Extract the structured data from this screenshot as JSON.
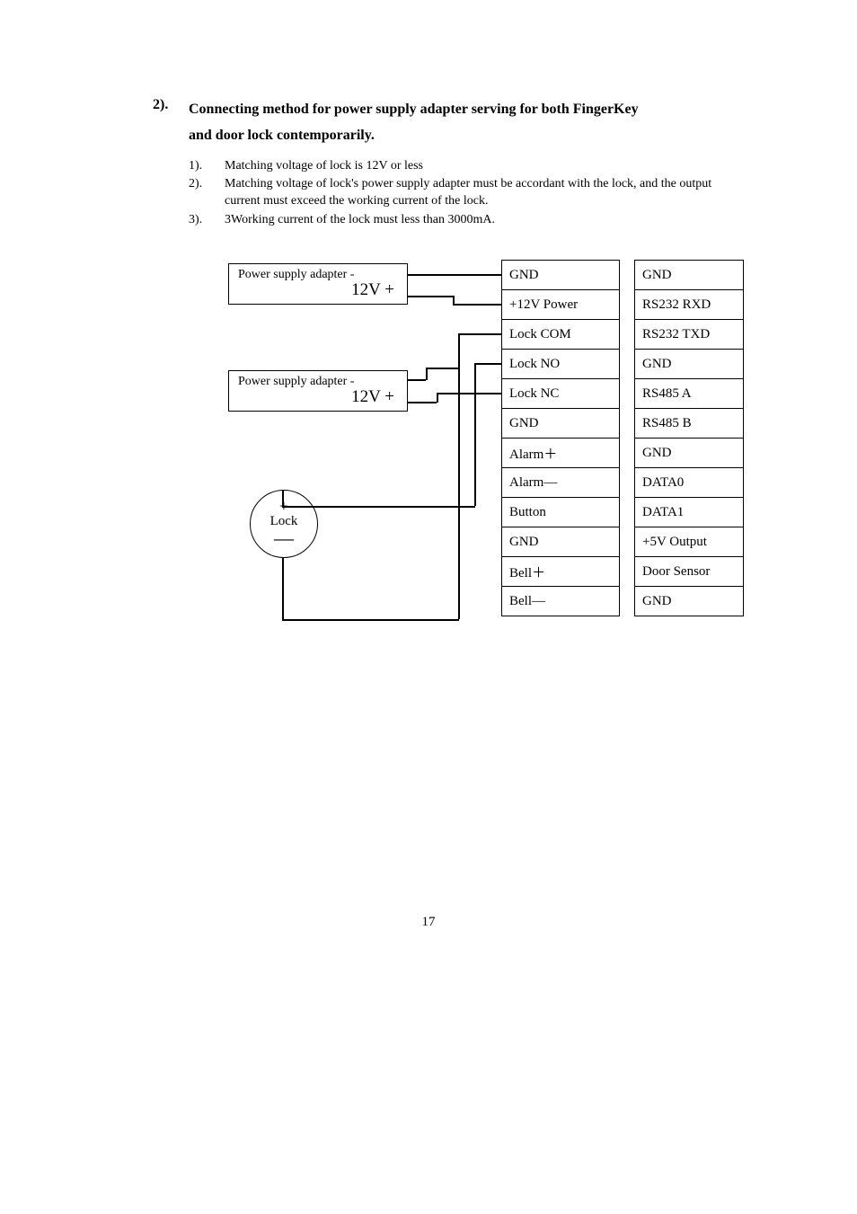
{
  "heading": {
    "number": "2).",
    "line1": "Connecting method for power supply adapter serving for both FingerKey",
    "line2": "and door lock contemporarily."
  },
  "list": [
    {
      "num": "1).",
      "text": "Matching voltage of lock is 12V or less"
    },
    {
      "num": "2).",
      "text": "Matching voltage of lock's power supply adapter must be accordant with the lock, and the output current must exceed the working current of the lock."
    },
    {
      "num": "3).",
      "text": "3Working current of the lock must less than 3000mA."
    }
  ],
  "diagram": {
    "psu1": {
      "line1": "Power supply adapter    -",
      "line2": "12V +"
    },
    "psu2": {
      "line1": "Power supply adapter    -",
      "line2": "12V +"
    },
    "lock": {
      "plus": "+",
      "label": "Lock",
      "minus": "—"
    },
    "left_pins": [
      "GND",
      "+12V    Power",
      "Lock COM",
      "Lock NO",
      "Lock NC",
      "GND",
      "Alarm＋",
      "Alarm—",
      "Button",
      "GND",
      "Bell＋",
      "Bell—"
    ],
    "right_pins": [
      "GND",
      "RS232 RXD",
      "RS232 TXD",
      "GND",
      "RS485 A",
      "RS485 B",
      "GND",
      "DATA0",
      "DATA1",
      "+5V Output",
      "Door Sensor",
      "GND"
    ]
  },
  "page_number": "17"
}
